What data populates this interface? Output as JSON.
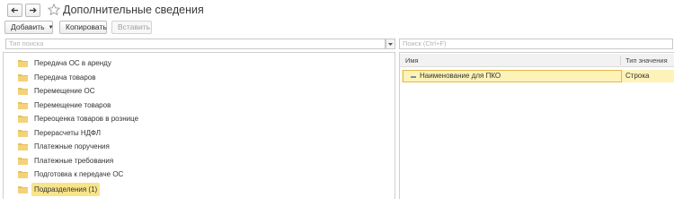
{
  "window": {
    "title": "Дополнительные сведения"
  },
  "toolbar": {
    "add_label": "Добавить",
    "copy_label": "Копировать",
    "paste_label": "Вставить"
  },
  "search": {
    "tree_placeholder": "Тип поиска",
    "grid_placeholder": "Поиск (Ctrl+F)"
  },
  "tree": {
    "items": [
      {
        "label": "Передача ОС в аренду"
      },
      {
        "label": "Передача товаров"
      },
      {
        "label": "Перемещение ОС"
      },
      {
        "label": "Перемещение товаров"
      },
      {
        "label": "Переоценка товаров в рознице"
      },
      {
        "label": "Перерасчеты НДФЛ"
      },
      {
        "label": "Платежные поручения"
      },
      {
        "label": "Платежные требования"
      },
      {
        "label": "Подготовка к передаче ОС"
      },
      {
        "label": "Подразделения (1)",
        "selected": true
      }
    ]
  },
  "grid": {
    "columns": [
      "Имя",
      "Тип значения"
    ],
    "rows": [
      {
        "name": "Наименование для ПКО",
        "type": "Строка",
        "selected": true
      }
    ]
  },
  "colors": {
    "selection_fill": "#fdf2b8",
    "tree_selection": "#f8e48a",
    "folder": "#e8c05a"
  }
}
